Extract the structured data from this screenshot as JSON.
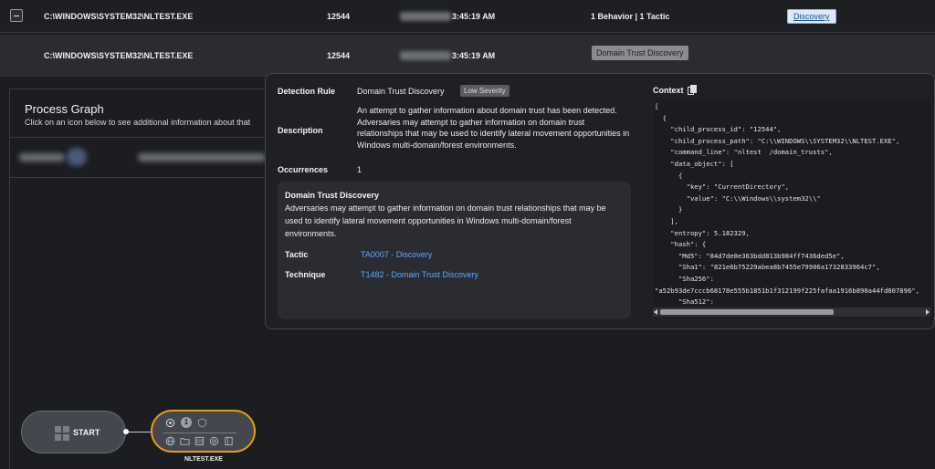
{
  "table": {
    "rows": [
      {
        "path": "C:\\WINDOWS\\SYSTEM32\\NLTEST.EXE",
        "pid": "12544",
        "time": "3:45:19 AM",
        "behavior": "1 Behavior | 1 Tactic",
        "tag": "Discovery"
      },
      {
        "path": "C:\\WINDOWS\\SYSTEM32\\NLTEST.EXE",
        "pid": "12544",
        "time": "3:45:19 AM",
        "tag": "Domain Trust Discovery"
      }
    ]
  },
  "graph": {
    "title": "Process Graph",
    "subtitle": "Click on an icon below to see additional information about that",
    "start_label": "START",
    "process_label": "NLTEST.EXE",
    "process_badge": "1"
  },
  "popover": {
    "detection_rule_label": "Detection Rule",
    "detection_rule_value": "Domain Trust Discovery",
    "severity": "Low Severity",
    "description_label": "Description",
    "description_value": "An attempt to gather information about domain trust has been detected. Adversaries may attempt to gather information on domain trust relationships that may be used to identify lateral movement opportunities in Windows multi-domain/forest environments.",
    "occurrences_label": "Occurrences",
    "occurrences_value": "1",
    "card": {
      "title": "Domain Trust Discovery",
      "text": "Adversaries may attempt to gather information on domain trust relationships that may be used to identify lateral movement opportunities in Windows multi-domain/forest environments.",
      "tactic_label": "Tactic",
      "tactic_value": "TA0007 - Discovery",
      "technique_label": "Technique",
      "technique_value": "T1482 - Domain Trust Discovery"
    },
    "context_label": "Context",
    "context_json": "[\n  {\n    \"child_process_id\": \"12544\",\n    \"child_process_path\": \"C:\\\\WINDOWS\\\\SYSTEM32\\\\NLTEST.EXE\",\n    \"command_line\": \"nltest  /domain_trusts\",\n    \"data_object\": [\n      {\n        \"key\": \"CurrentDirectory\",\n        \"value\": \"C:\\\\Windows\\\\system32\\\\\"\n      }\n    ],\n    \"entropy\": 5.182329,\n    \"hash\": {\n      \"Md5\": \"84d7de0e363bdd813b984ff7436ded5e\",\n      \"Sha1\": \"821e6b75229abea8b7455e79906a1732833964c7\",\n      \"Sha256\":\n\"a52b93de7cccb68178e555b1851b1f312199f225fafaa1916b890a44fd807896\",\n      \"Sha512\":"
  },
  "colors": {
    "accent_orange": "#e89a14",
    "link_blue": "#5aa8ff"
  }
}
